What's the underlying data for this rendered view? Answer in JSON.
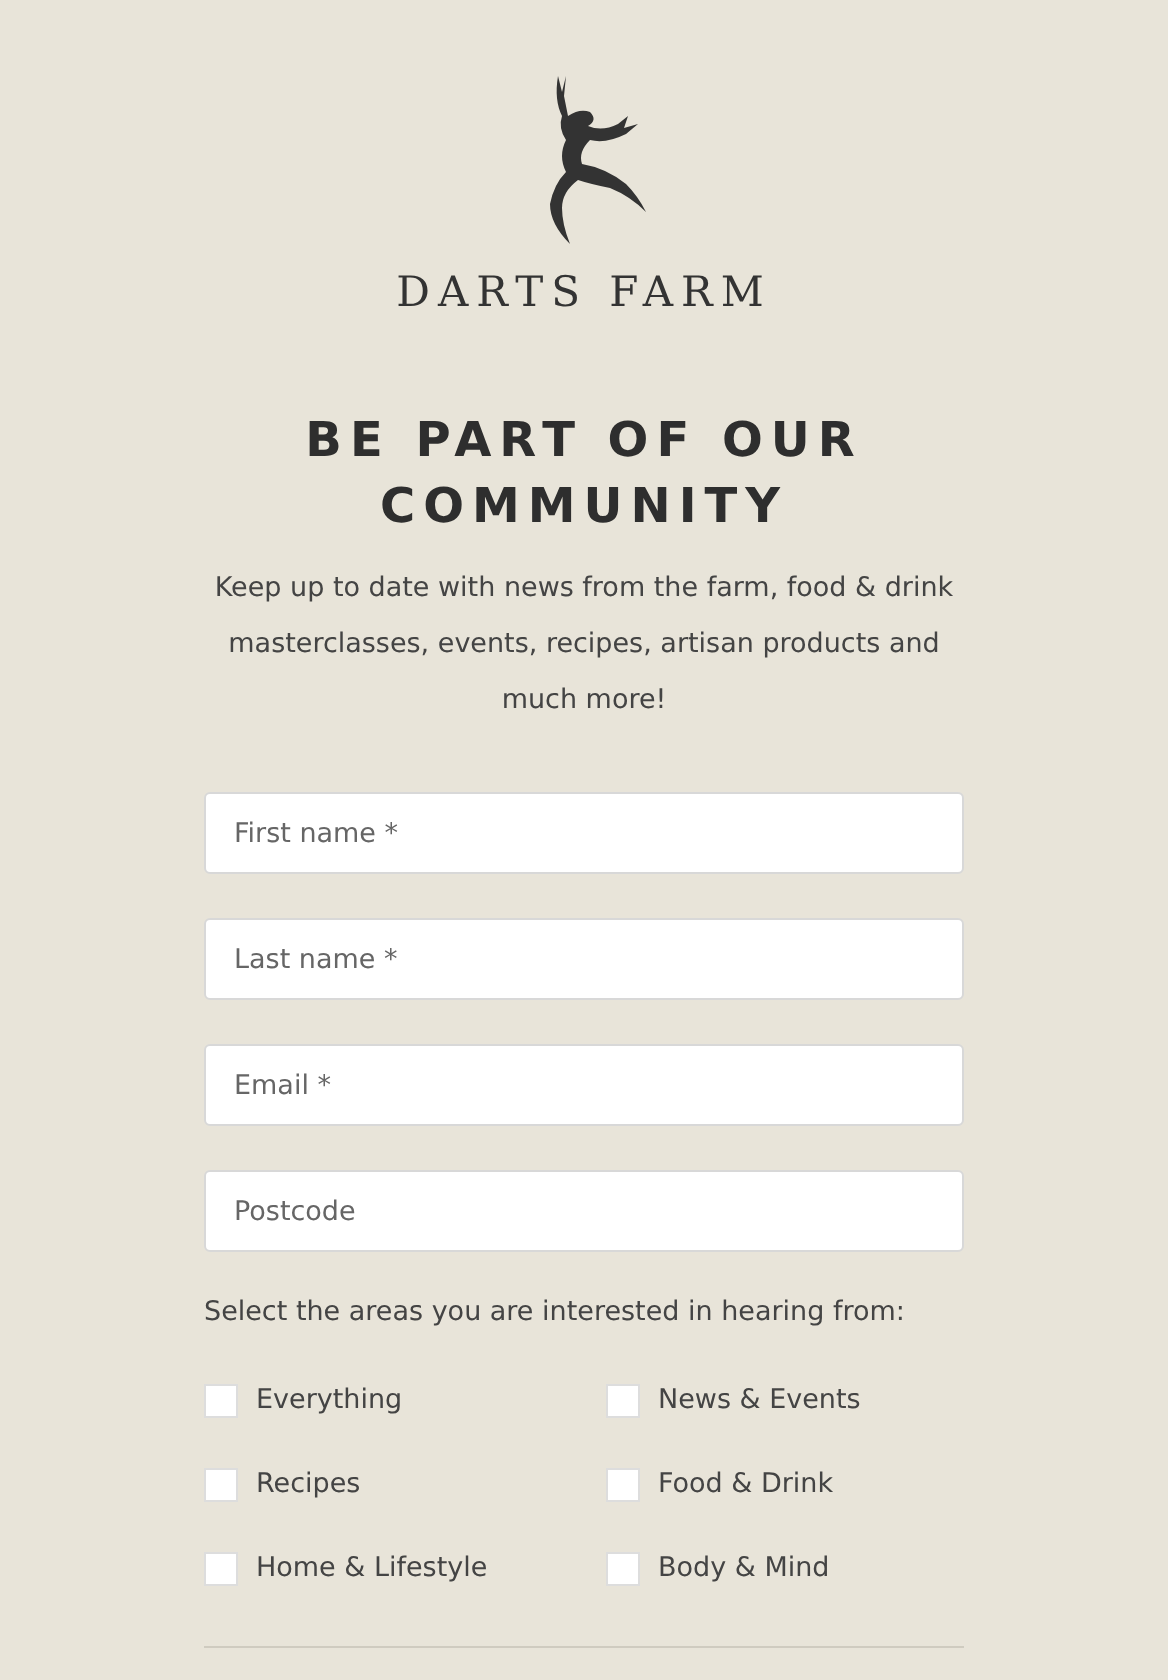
{
  "brand": {
    "name": "DARTS FARM"
  },
  "heading": "BE PART OF OUR COMMUNITY",
  "intro": "Keep up to date with news from the farm, food & drink masterclasses, events, recipes, artisan products and much more!",
  "fields": [
    {
      "placeholder": "First name *"
    },
    {
      "placeholder": "Last name *"
    },
    {
      "placeholder": "Email *"
    },
    {
      "placeholder": "Postcode"
    }
  ],
  "interests_label": "Select the areas you are interested in hearing from:",
  "interests": [
    {
      "label": "Everything",
      "checked": false
    },
    {
      "label": "News & Events",
      "checked": false
    },
    {
      "label": "Recipes",
      "checked": false
    },
    {
      "label": "Food & Drink",
      "checked": false
    },
    {
      "label": "Home & Lifestyle",
      "checked": false
    },
    {
      "label": "Body & Mind",
      "checked": false
    }
  ]
}
